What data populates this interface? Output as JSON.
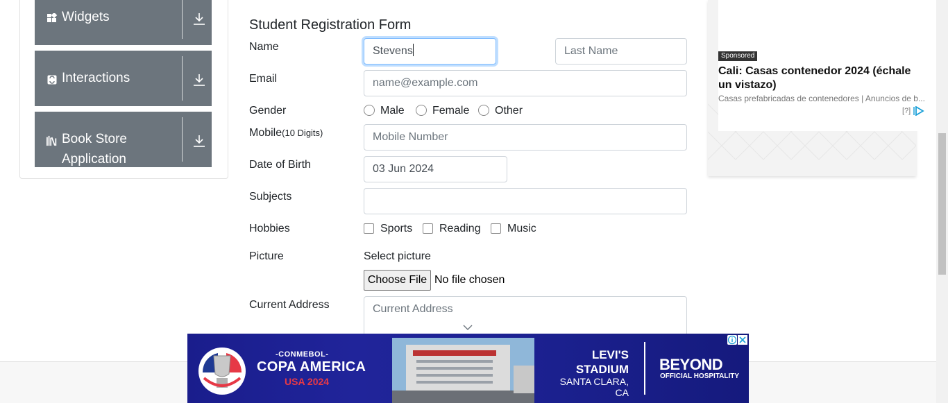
{
  "sidebar": {
    "groups": [
      {
        "label": "Widgets",
        "icon": "widgets-icon"
      },
      {
        "label": "Interactions",
        "icon": "interactions-icon"
      },
      {
        "label_line1": "Book Store",
        "label_line2": "Application",
        "icon": "book-store-icon"
      }
    ]
  },
  "form": {
    "title": "Student Registration Form",
    "name_label": "Name",
    "first_name_value": "Stevens",
    "last_name_placeholder": "Last Name",
    "email_label": "Email",
    "email_placeholder": "name@example.com",
    "gender_label": "Gender",
    "gender_options": [
      "Male",
      "Female",
      "Other"
    ],
    "mobile_label": "Mobile",
    "mobile_hint": "(10 Digits)",
    "mobile_placeholder": "Mobile Number",
    "dob_label": "Date of Birth",
    "dob_value": "03 Jun 2024",
    "subjects_label": "Subjects",
    "subjects_value": "",
    "hobbies_label": "Hobbies",
    "hobbies_options": [
      "Sports",
      "Reading",
      "Music"
    ],
    "picture_label": "Picture",
    "select_picture": "Select picture",
    "choose_file": "Choose File",
    "file_status": "No file chosen",
    "address_label": "Current Address",
    "address_placeholder": "Current Address"
  },
  "right_ad": {
    "sponsored": "Sponsored",
    "headline": "Cali: Casas contenedor 2024 (échale un vistazo)",
    "subline": "Casas prefabricadas de contenedores | Anuncios de b...",
    "help": "[?]"
  },
  "banner_ad": {
    "conmebol": "-CONMEBOL-",
    "copa": "COPA AMERICA",
    "usa": "USA 2024",
    "levis": "LEVI'S STADIUM",
    "santa_clara": "SANTA CLARA, CA",
    "beyond": "BEYOND",
    "official": "OFFICIAL HOSPITALITY"
  },
  "colors": {
    "sidebar_group": "#6c757d",
    "focus_border": "#80bdff",
    "banner_blue": "#1b1f8a"
  }
}
